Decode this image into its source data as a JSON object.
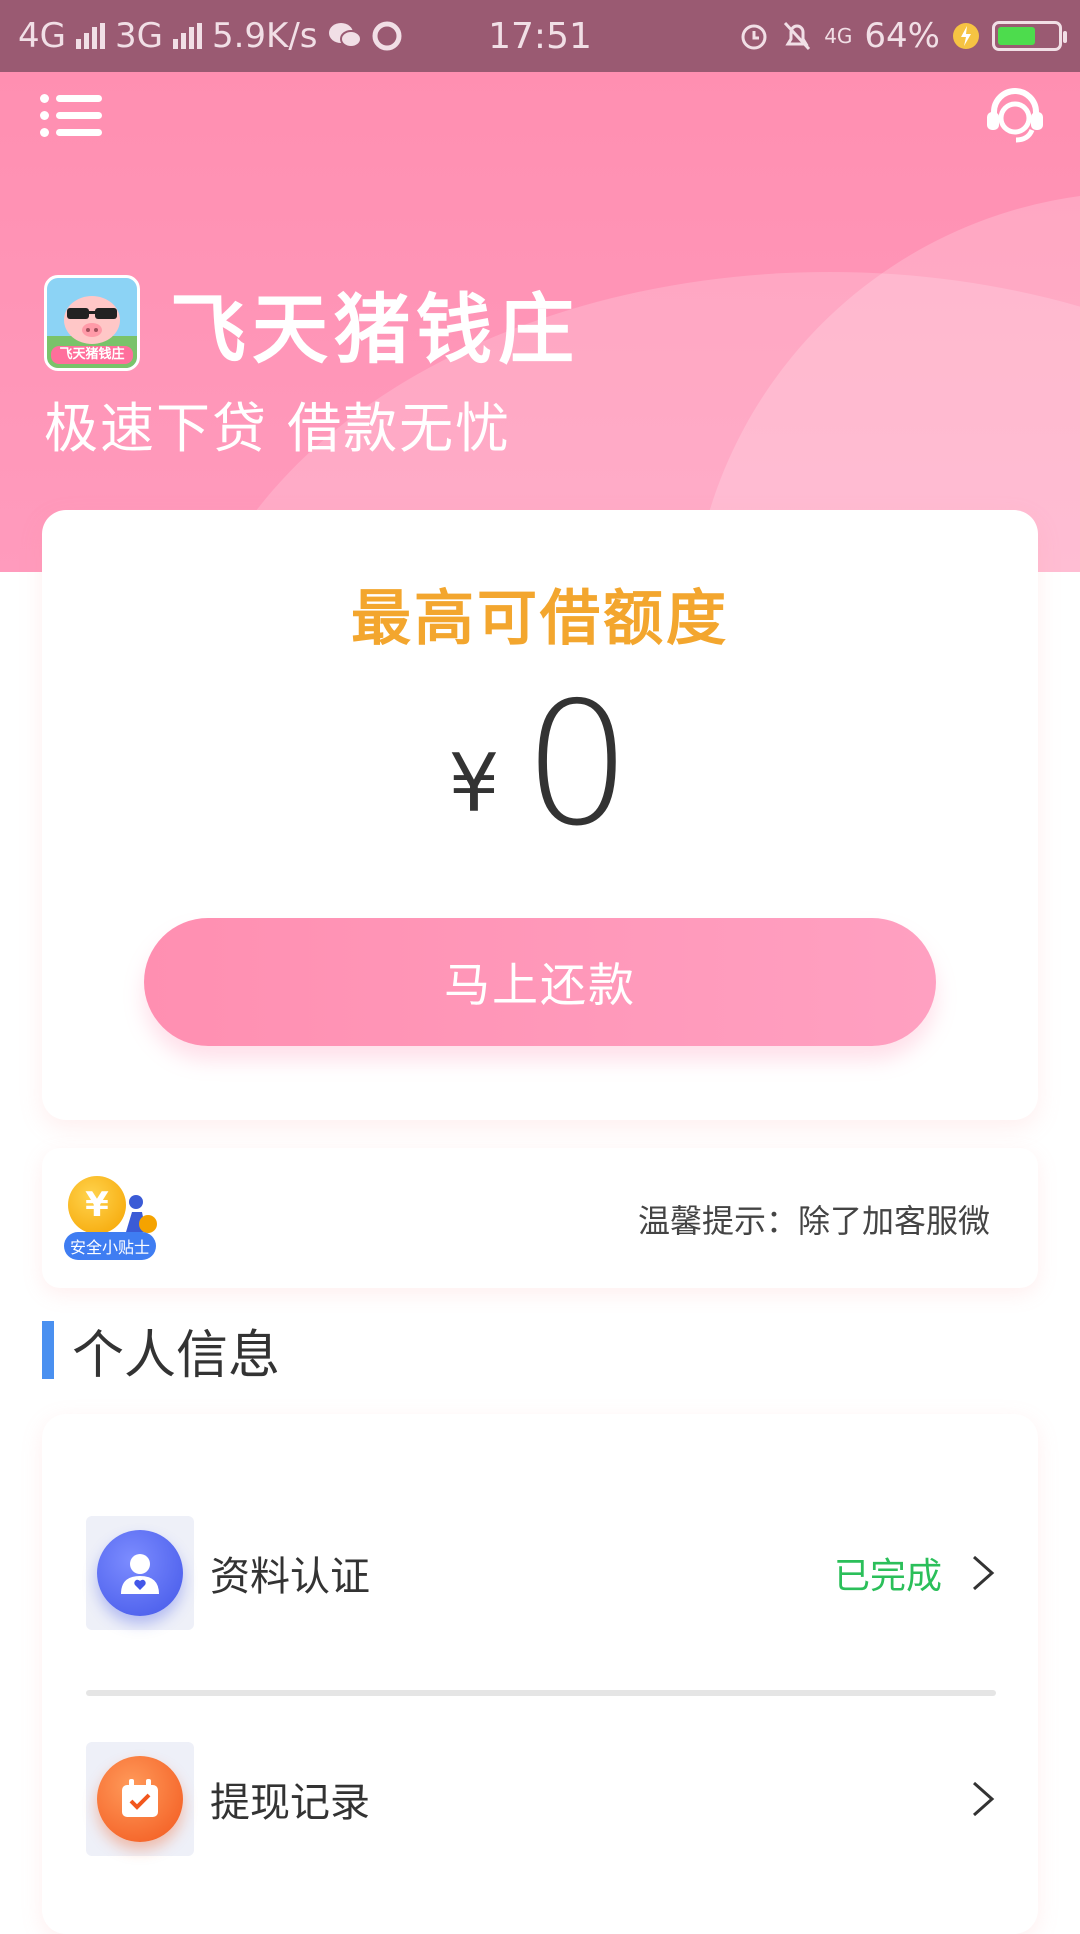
{
  "status_bar": {
    "network_1": "4G",
    "network_2": "3G",
    "speed": "5.9K/s",
    "time": "17:51",
    "network_3": "4G",
    "battery": "64%"
  },
  "header": {
    "brand_name": "飞天猪钱庄",
    "logo_text": "飞天猪钱庄",
    "slogan": "极速下贷 借款无忧"
  },
  "limit_card": {
    "title": "最高可借额度",
    "currency": "¥",
    "amount": "0",
    "button_label": "马上还款"
  },
  "tips": {
    "badge_label": "安全小贴士",
    "coin_symbol": "¥",
    "text": "温馨提示：除了加客服微"
  },
  "personal_info": {
    "section_title": "个人信息",
    "items": [
      {
        "label": "资料认证",
        "status": "已完成",
        "icon": "user-verify-icon"
      },
      {
        "label": "提现记录",
        "status": "",
        "icon": "calendar-check-icon"
      }
    ]
  },
  "colors": {
    "primary_pink": "#ff8fb1",
    "limit_title": "#f3a62e",
    "status_done": "#2bbf5a",
    "section_accent": "#4a90f0"
  }
}
